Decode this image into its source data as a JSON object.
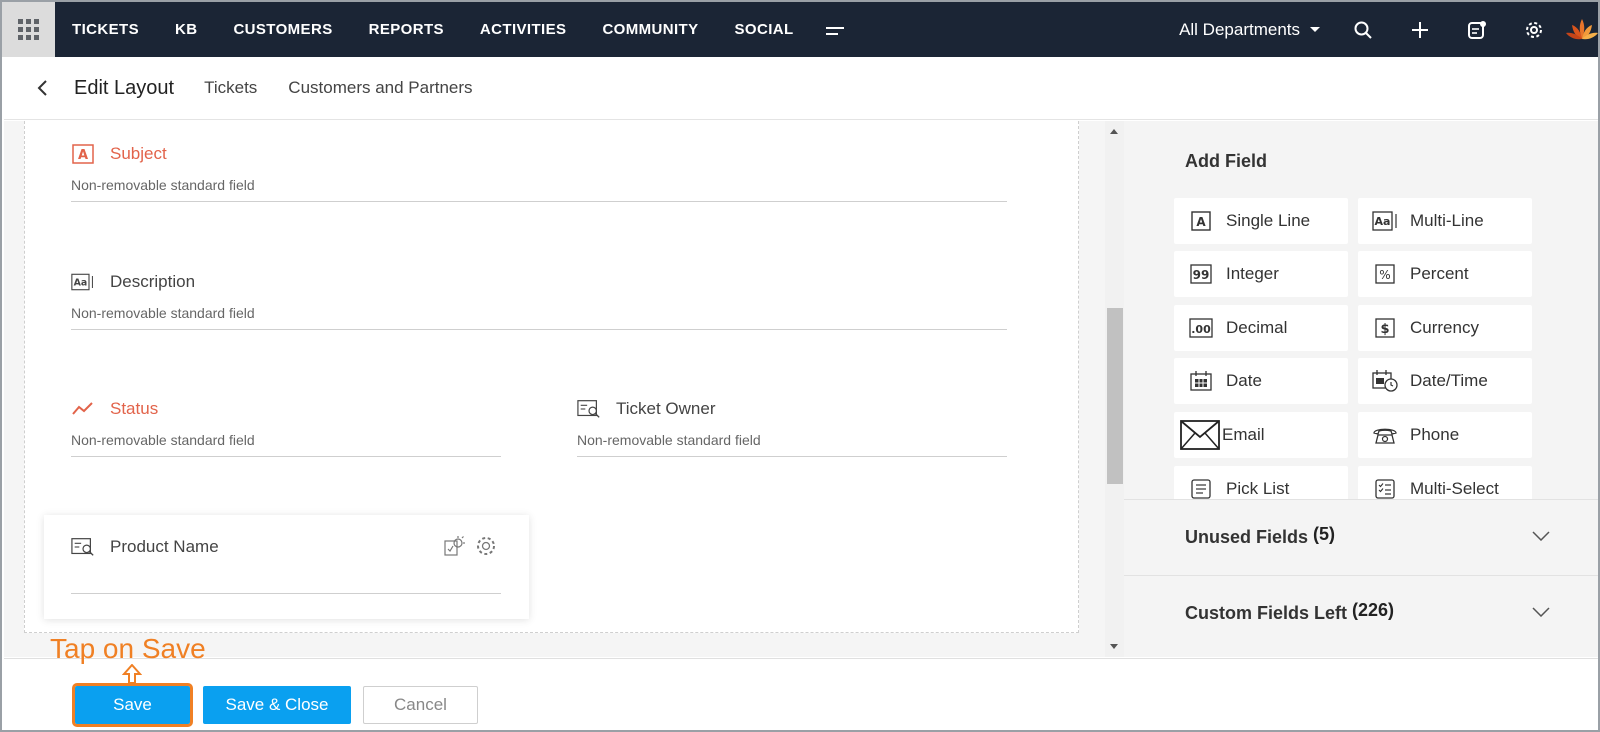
{
  "topnav": {
    "items": [
      "TICKETS",
      "KB",
      "CUSTOMERS",
      "REPORTS",
      "ACTIVITIES",
      "COMMUNITY",
      "SOCIAL"
    ],
    "department": "All Departments",
    "icons": [
      "search-icon",
      "plus-icon",
      "notes-icon",
      "gear-icon",
      "avatar-logo"
    ]
  },
  "subheader": {
    "title": "Edit Layout",
    "crumbs": [
      "Tickets",
      "Customers and Partners"
    ]
  },
  "fields": {
    "subject": {
      "label": "Subject",
      "note": "Non-removable standard field"
    },
    "description": {
      "label": "Description",
      "note": "Non-removable standard field"
    },
    "status": {
      "label": "Status",
      "note": "Non-removable standard field"
    },
    "ticket_owner": {
      "label": "Ticket Owner",
      "note": "Non-removable standard field"
    },
    "product_name": {
      "label": "Product Name"
    }
  },
  "add_field": {
    "title": "Add Field",
    "tiles": [
      "Single Line",
      "Multi-Line",
      "Integer",
      "Percent",
      "Decimal",
      "Currency",
      "Date",
      "Date/Time",
      "Email",
      "Phone",
      "Pick List",
      "Multi-Select"
    ]
  },
  "accordions": {
    "unused": {
      "title": "Unused Fields",
      "count": "(5)"
    },
    "custom": {
      "title": "Custom Fields Left",
      "count": "(226)"
    }
  },
  "footer": {
    "save": "Save",
    "save_close": "Save & Close",
    "cancel": "Cancel"
  },
  "annotation": "Tap on Save",
  "colors": {
    "nav_bg": "#1b2535",
    "accent_blue": "#0aa0f0",
    "required_red": "#e2634a",
    "annotation_orange": "#f08024"
  }
}
